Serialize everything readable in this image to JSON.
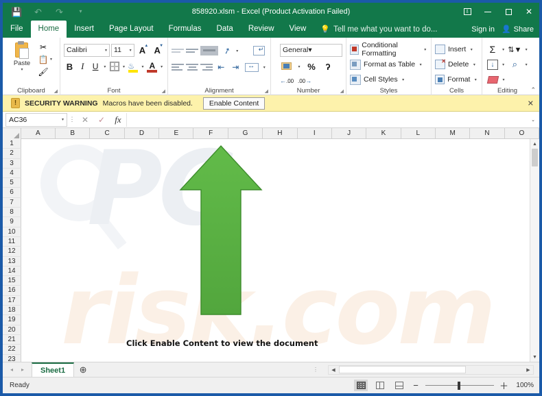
{
  "titlebar": {
    "document_title": "858920.xlsm - Excel (Product Activation Failed)",
    "qat": [
      {
        "name": "save",
        "glyph": "⬒"
      },
      {
        "name": "undo",
        "glyph": "↶"
      },
      {
        "name": "redo",
        "glyph": "↷"
      },
      {
        "name": "customize-qat",
        "glyph": "▾"
      }
    ],
    "window_controls": [
      {
        "name": "ribbon-display-options",
        "glyph": "⬜"
      },
      {
        "name": "minimize",
        "glyph": "–"
      },
      {
        "name": "maximize",
        "glyph": "□"
      },
      {
        "name": "close",
        "glyph": "✕"
      }
    ]
  },
  "tabs": [
    {
      "label": "File",
      "active": false
    },
    {
      "label": "Home",
      "active": true
    },
    {
      "label": "Insert",
      "active": false
    },
    {
      "label": "Page Layout",
      "active": false
    },
    {
      "label": "Formulas",
      "active": false
    },
    {
      "label": "Data",
      "active": false
    },
    {
      "label": "Review",
      "active": false
    },
    {
      "label": "View",
      "active": false
    }
  ],
  "tellme": {
    "placeholder": "Tell me what you want to do...",
    "icon": "lightbulb-icon"
  },
  "account": {
    "signin_label": "Sign in",
    "share_label": "Share",
    "share_icon": "person-share-icon"
  },
  "ribbon": {
    "groups": [
      {
        "label": "Clipboard"
      },
      {
        "label": "Font"
      },
      {
        "label": "Alignment"
      },
      {
        "label": "Number"
      },
      {
        "label": "Styles"
      },
      {
        "label": "Cells"
      },
      {
        "label": "Editing"
      }
    ],
    "clipboard": {
      "paste_label": "Paste",
      "cut_label": "",
      "copy_label": "",
      "format_painter_label": ""
    },
    "font": {
      "font_name": "Calibri",
      "font_size": "11",
      "bold": "B",
      "italic": "I",
      "underline": "U",
      "grow_font": "A",
      "shrink_font": "A",
      "font_color_letter": "A"
    },
    "number": {
      "format": "General",
      "percent": "%",
      "comma": "ʔ",
      "increase_decimal": ".00",
      "decrease_decimal": ".00"
    },
    "styles": {
      "conditional_formatting": "Conditional Formatting",
      "format_as_table": "Format as Table",
      "cell_styles": "Cell Styles"
    },
    "cells": {
      "insert": "Insert",
      "delete": "Delete",
      "format": "Format"
    },
    "editing": {
      "autosum": "Σ",
      "sort_filter": "A\nZ",
      "fill": "↓",
      "find_select": "⌕",
      "clear": ""
    },
    "collapse_glyph": "⌃"
  },
  "security_warning": {
    "icon": "warning-shield-icon",
    "label": "SECURITY WARNING",
    "message": "Macros have been disabled.",
    "button": "Enable Content",
    "close_glyph": "✕"
  },
  "formula_bar": {
    "name_box_value": "AC36",
    "cancel_glyph": "✕",
    "enter_glyph": "✓",
    "fx_label": "fx",
    "formula_value": "",
    "expand_glyph": "⌄"
  },
  "grid": {
    "columns": [
      "A",
      "B",
      "C",
      "D",
      "E",
      "F",
      "G",
      "H",
      "I",
      "J",
      "K",
      "L",
      "M",
      "N",
      "O"
    ],
    "rows": [
      "1",
      "2",
      "3",
      "4",
      "5",
      "6",
      "7",
      "8",
      "9",
      "10",
      "11",
      "12",
      "13",
      "14",
      "15",
      "16",
      "17",
      "18",
      "19",
      "20",
      "21",
      "22",
      "23"
    ],
    "call_to_action": "Click Enable Content to view the document",
    "arrow": {
      "name": "up-arrow-graphic",
      "fill_color": "#5cb446",
      "stroke_color": "#3d8c2c"
    },
    "watermark": {
      "line1": "PC",
      "line2": "risk.com"
    }
  },
  "sheet_bar": {
    "prev_glyph": "◂",
    "next_glyph": "▸",
    "sheets": [
      {
        "name": "Sheet1",
        "active": true
      }
    ],
    "add_sheet_glyph": "⊕"
  },
  "status_bar": {
    "status_text": "Ready",
    "views": [
      {
        "name": "normal-view",
        "active": true
      },
      {
        "name": "page-layout-view",
        "active": false
      },
      {
        "name": "page-break-preview",
        "active": false
      }
    ],
    "zoom_out_glyph": "−",
    "zoom_in_glyph": "＋",
    "zoom_value": "100%"
  },
  "colors": {
    "excel_green": "#12784a",
    "arrow_green": "#5cb446",
    "warning_yellow": "#fdf2ab",
    "window_border_blue": "#1b5aa8"
  }
}
